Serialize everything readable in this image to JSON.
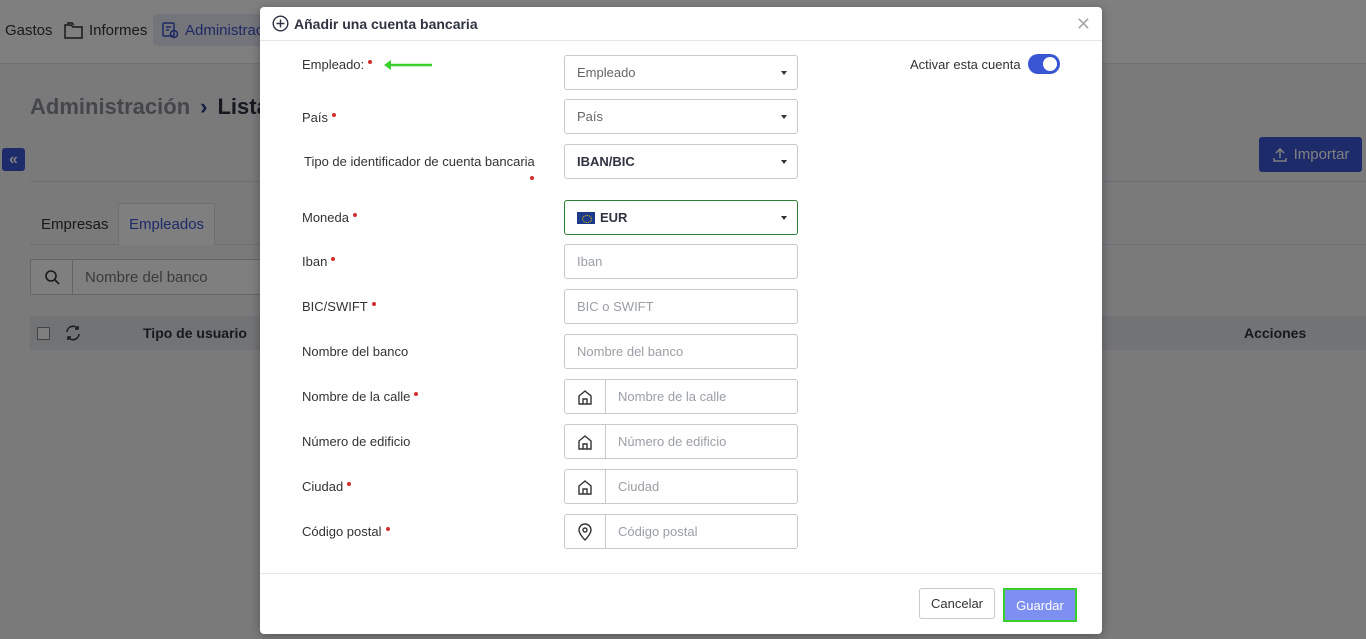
{
  "nav": {
    "gastos": "Gastos",
    "informes": "Informes",
    "admin": "Administrac"
  },
  "breadcrumb": {
    "root": "Administración",
    "current": "Lista"
  },
  "toolbar": {
    "import": "Importar"
  },
  "tabs": {
    "empresas": "Empresas",
    "empleados": "Empleados"
  },
  "search": {
    "placeholder": "Nombre del banco"
  },
  "table": {
    "col_tipo": "Tipo de usuario",
    "col_acciones": "Acciones"
  },
  "modal": {
    "title": "Añadir una cuenta bancaria",
    "toggle_label": "Activar esta cuenta",
    "fields": {
      "empleado": {
        "label": "Empleado:",
        "placeholder": "Empleado"
      },
      "pais": {
        "label": "País",
        "placeholder": "País"
      },
      "tipo": {
        "label": "Tipo de identificador de cuenta bancaria",
        "value": "IBAN/BIC"
      },
      "moneda": {
        "label": "Moneda",
        "value": "EUR"
      },
      "iban": {
        "label": "Iban",
        "placeholder": "Iban"
      },
      "bic": {
        "label": "BIC/SWIFT",
        "placeholder": "BIC o SWIFT"
      },
      "banco": {
        "label": "Nombre del banco",
        "placeholder": "Nombre del banco"
      },
      "calle": {
        "label": "Nombre de la calle",
        "placeholder": "Nombre de la calle"
      },
      "edificio": {
        "label": "Número de edificio",
        "placeholder": "Número de edificio"
      },
      "ciudad": {
        "label": "Ciudad",
        "placeholder": "Ciudad"
      },
      "postal": {
        "label": "Código postal",
        "placeholder": "Código postal"
      }
    },
    "cancel": "Cancelar",
    "save": "Guardar"
  },
  "colors": {
    "accent": "#3a56d4",
    "highlight": "#39d02e",
    "required": "#d32f2f"
  }
}
